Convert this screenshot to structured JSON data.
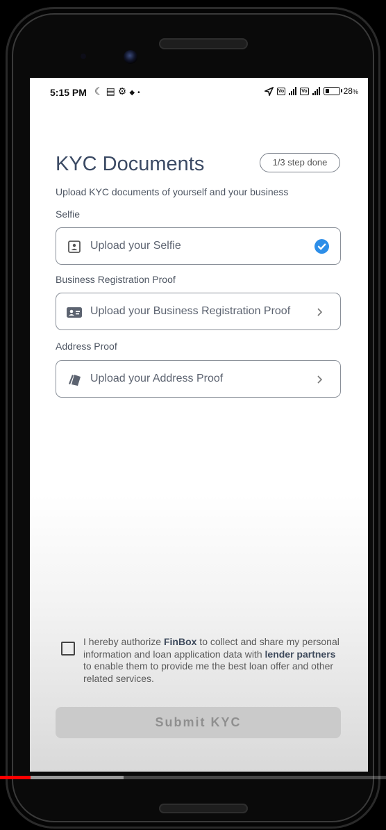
{
  "status_bar": {
    "time": "5:15 PM",
    "battery_text": "28",
    "battery_unit": "%",
    "left_icons": [
      "moon-icon",
      "message-icon",
      "gear-icon",
      "navigation-icon",
      "dot-icon"
    ],
    "right_icons": [
      "location-arrow-icon",
      "volte-icon",
      "4g-signal-icon",
      "volte-icon",
      "signal-icon",
      "battery-icon"
    ],
    "battery_level": 0.28
  },
  "header": {
    "title": "KYC Documents",
    "step_badge": "1/3 step done",
    "subtitle": "Upload KYC documents of yourself and your business"
  },
  "sections": [
    {
      "label": "Selfie",
      "card_text": "Upload your Selfie",
      "icon": "portrait-icon",
      "state": "completed"
    },
    {
      "label": "Business Registration Proof",
      "card_text": "Upload your Business Registration Proof",
      "icon": "id-card-icon",
      "state": "pending"
    },
    {
      "label": "Address Proof",
      "card_text": "Upload your Address Proof",
      "icon": "document-icon",
      "state": "pending"
    }
  ],
  "consent": {
    "part1": "I hereby authorize ",
    "brand": "FinBox",
    "part2": " to collect and share my personal information and loan application data with ",
    "partners": "lender partners",
    "part3": " to enable them to provide me the best loan offer and other related services.",
    "checked": false
  },
  "submit_label": "Submit KYC",
  "colors": {
    "title": "#3b4a64",
    "check_accent": "#2d8ee8",
    "submit_bg": "#cacaca",
    "video_progress": "#ff0000"
  },
  "video_progress": {
    "played_fraction": 0.08,
    "buffered_fraction": 0.32
  }
}
